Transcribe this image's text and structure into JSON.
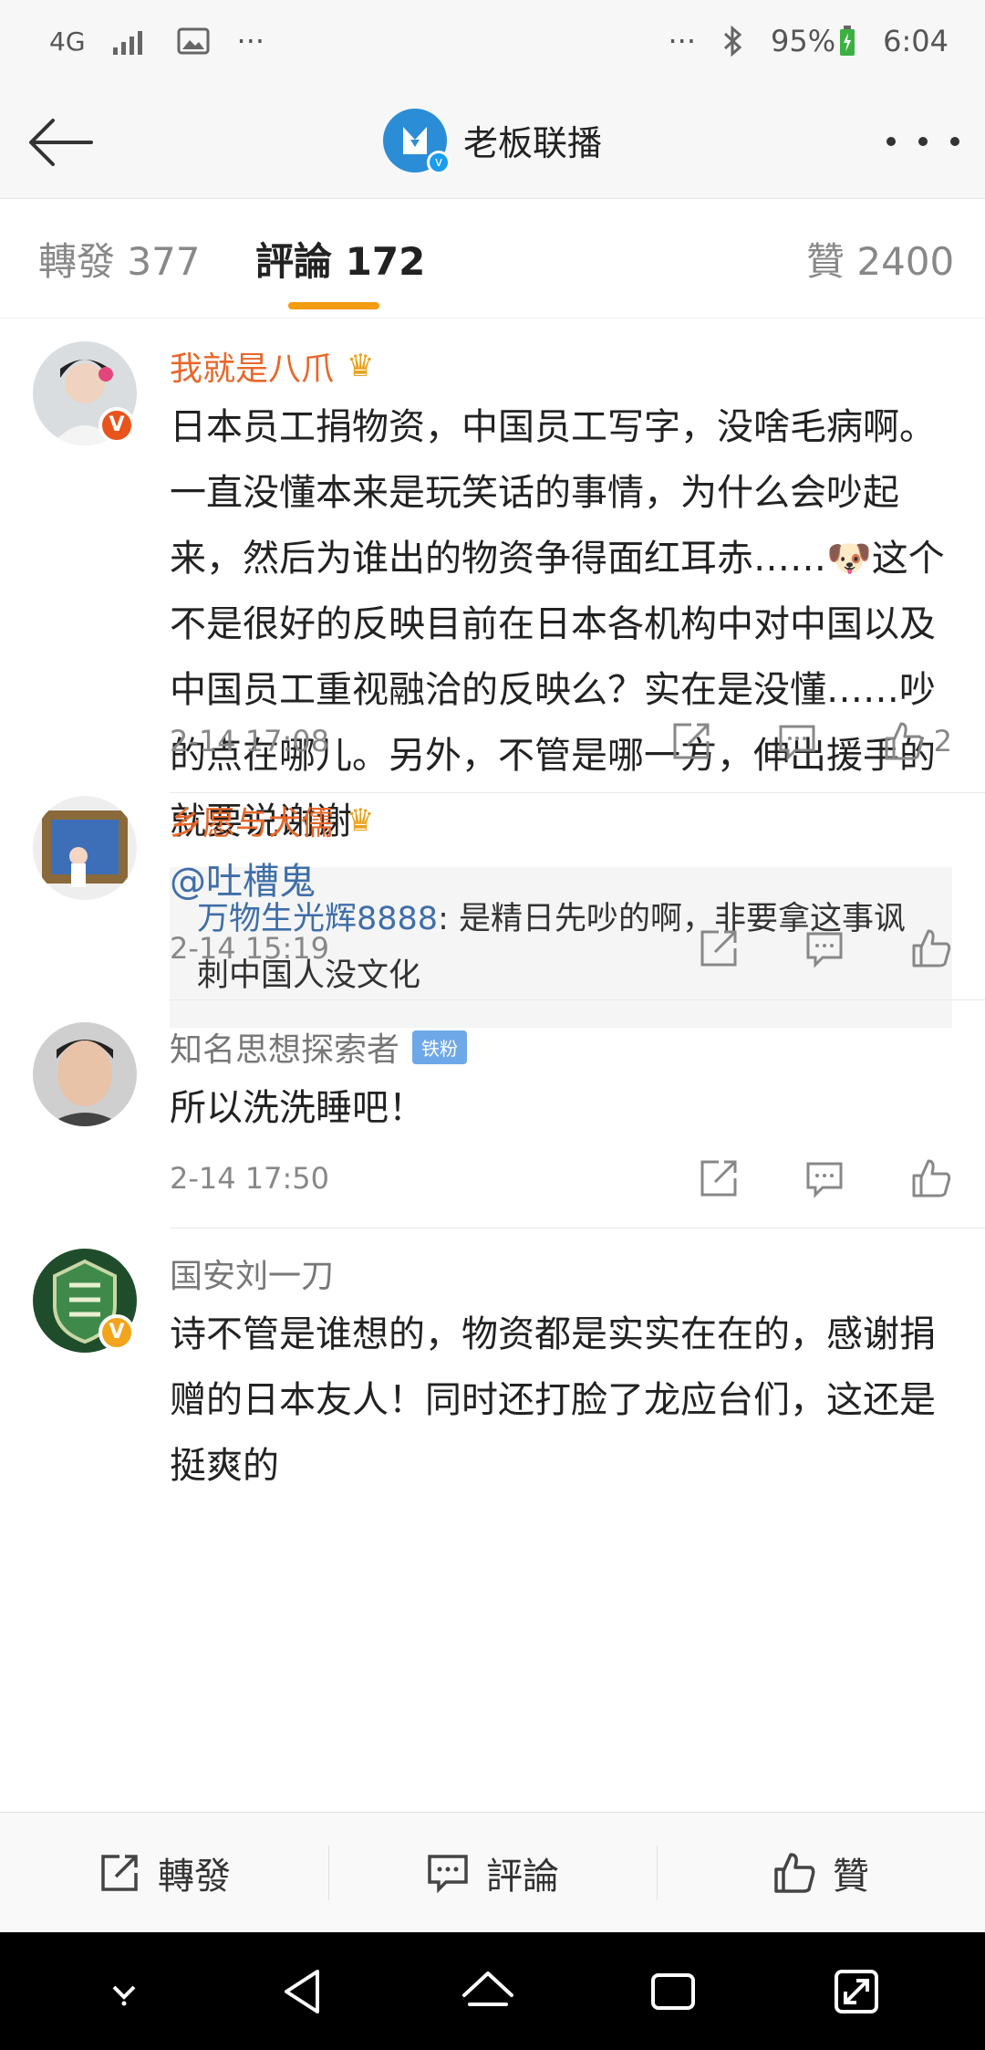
{
  "status_bar": {
    "network": "4G",
    "more": "···",
    "notif_more": "···",
    "battery": "95%",
    "time": "6:04"
  },
  "header": {
    "title": "老板联播",
    "avatar_badge": "v"
  },
  "tabs": [
    {
      "label": "轉發 377"
    },
    {
      "label": "評論 172"
    },
    {
      "label": "贊 2400"
    }
  ],
  "comments": [
    {
      "name": "我就是八爪",
      "vip": true,
      "badge": "V",
      "text": "日本员工捐物资，中国员工写字，没啥毛病啊。一直没懂本来是玩笑话的事情，为什么会吵起来，然后为谁出的物资争得面红耳赤……🐶这个不是很好的反映目前在日本各机构中对中国以及中国员工重视融洽的反映么？实在是没懂……吵的点在哪儿。另外，不管是哪一方，伸出援手的就要说谢谢",
      "reply_name": "万物生光辉8888",
      "reply_text": ": 是精日先吵的啊，非要拿这事讽刺中国人没文化",
      "time": "2-14 17:08",
      "likes": "2"
    },
    {
      "name": "乡愿与犬儒",
      "vip": true,
      "text": "@吐槽鬼",
      "time": "2-14 15:19"
    },
    {
      "name": "知名思想探索者",
      "fan_badge": "铁粉",
      "text": "所以洗洗睡吧！",
      "time": "2-14 17:50"
    },
    {
      "name": "国安刘一刀",
      "badge": "V",
      "text": "诗不管是谁想的，物资都是实实在在的，感谢捐赠的日本友人！同时还打脸了龙应台们，这还是挺爽的"
    }
  ],
  "bottom_bar": {
    "repost": "轉發",
    "comment": "評論",
    "like": "贊"
  },
  "colors": {
    "accent": "#f39c12",
    "vip_name": "#e8672a",
    "link": "#3f6ea8"
  }
}
